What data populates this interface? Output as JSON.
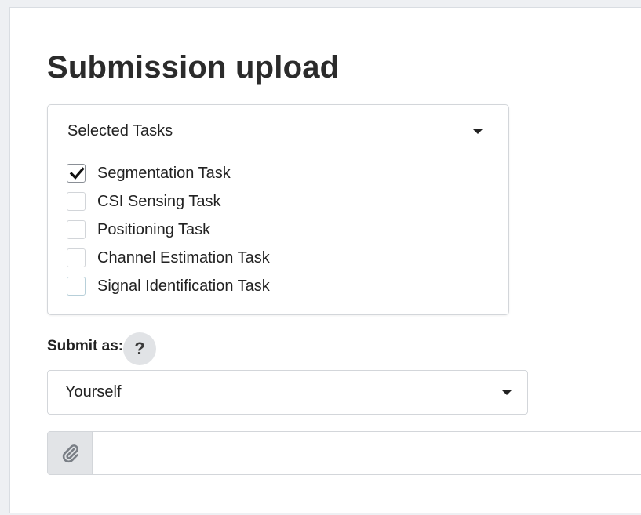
{
  "page": {
    "title": "Submission upload"
  },
  "tasks": {
    "header_label": "Selected Tasks",
    "items": [
      {
        "label": "Segmentation Task",
        "checked": true
      },
      {
        "label": "CSI Sensing Task",
        "checked": false
      },
      {
        "label": "Positioning Task",
        "checked": false
      },
      {
        "label": "Channel Estimation Task",
        "checked": false
      },
      {
        "label": "Signal Identification Task",
        "checked": false
      }
    ]
  },
  "submit_as": {
    "label": "Submit as:",
    "help_symbol": "?",
    "selected_value": "Yourself"
  },
  "upload": {
    "icon": "paperclip-icon",
    "value": ""
  },
  "icons": {
    "dropdown": "caret-down-icon",
    "check": "checkmark-icon",
    "help": "question-mark-icon"
  },
  "colors": {
    "page_background": "#eef0f3",
    "card_background": "#ffffff",
    "text": "#222222",
    "help_button_background": "#e1e3e6",
    "attach_button_background": "#e2e4e7",
    "border": "#d3d6da"
  }
}
